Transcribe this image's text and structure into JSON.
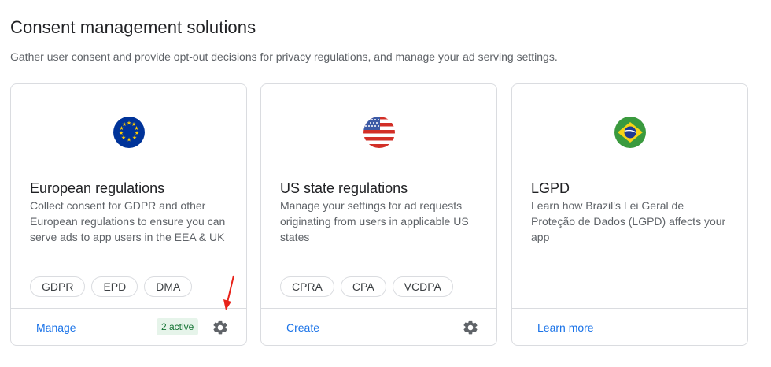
{
  "header": {
    "title": "Consent management solutions",
    "subtitle": "Gather user consent and provide opt-out decisions for privacy regulations, and manage your ad serving settings."
  },
  "cards": [
    {
      "title": "European regulations",
      "description": "Collect consent for GDPR and other European regulations to ensure you can serve ads to app users in the EEA & UK",
      "chips": [
        "GDPR",
        "EPD",
        "DMA"
      ],
      "action": "Manage",
      "badge": "2 active",
      "icon": "eu-flag-icon"
    },
    {
      "title": "US state regulations",
      "description": "Manage your settings for ad requests originating from users in applicable US states",
      "chips": [
        "CPRA",
        "CPA",
        "VCDPA"
      ],
      "action": "Create",
      "icon": "us-flag-icon"
    },
    {
      "title": "LGPD",
      "description": "Learn how Brazil's Lei Geral de Proteção de Dados (LGPD) affects your app",
      "action": "Learn more",
      "icon": "brazil-flag-icon"
    }
  ],
  "colors": {
    "link": "#1a73e8",
    "badge_bg": "#e6f4ea",
    "badge_text": "#137333",
    "annotation_arrow": "#e8231a"
  }
}
